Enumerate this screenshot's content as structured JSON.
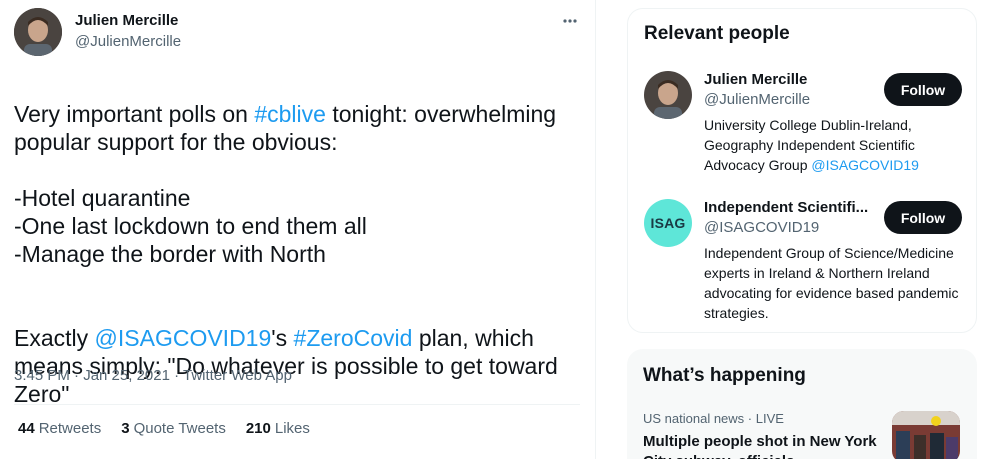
{
  "tweet": {
    "author": {
      "name": "Julien Mercille",
      "handle": "@JulienMercille"
    },
    "text_segments": [
      {
        "text": "Very important polls on ",
        "link": false
      },
      {
        "text": "#cblive",
        "link": true
      },
      {
        "text": " tonight: overwhelming popular support for the obvious:",
        "link": false
      }
    ],
    "list_lines": [
      "-Hotel quarantine",
      "-One last lockdown to end them all",
      "-Manage the border with North"
    ],
    "closing_segments": [
      {
        "text": "Exactly ",
        "link": false
      },
      {
        "text": "@ISAGCOVID19",
        "link": true
      },
      {
        "text": "'s ",
        "link": false
      },
      {
        "text": "#ZeroCovid",
        "link": true
      },
      {
        "text": " plan, which means simply: \"Do whatever is possible to get toward Zero\"",
        "link": false
      }
    ],
    "timestamp": "3:45 PM · Jan 25, 2021",
    "separator": " · ",
    "app": "Twitter Web App",
    "stats": [
      {
        "count": "44",
        "label": "Retweets"
      },
      {
        "count": "3",
        "label": "Quote Tweets"
      },
      {
        "count": "210",
        "label": "Likes"
      }
    ]
  },
  "relevant_people": {
    "title": "Relevant people",
    "people": [
      {
        "name": "Julien Mercille",
        "handle": "@JulienMercille",
        "bio": "University College Dublin-Ireland, Geography Independent Scientific Advocacy Group ",
        "bio_link": "@ISAGCOVID19",
        "button": "Follow"
      },
      {
        "name": "Independent Scientifi...",
        "handle": "@ISAGCOVID19",
        "bio": "Independent Group of Science/Medicine experts in Ireland & Northern Ireland advocating for evidence based pandemic strategies.",
        "bio_link": "",
        "button": "Follow",
        "logo_text": "ISAG"
      }
    ]
  },
  "whats_happening": {
    "title": "What’s happening",
    "trend": {
      "category": "US national news · LIVE",
      "title": "Multiple people shot in New York City subway, officials"
    }
  },
  "colors": {
    "accent": "#1d9bf0",
    "text": "#0f1419",
    "secondary": "#536471",
    "button": "#0f1419"
  },
  "icons": {
    "more": "more-horizontal-icon"
  }
}
